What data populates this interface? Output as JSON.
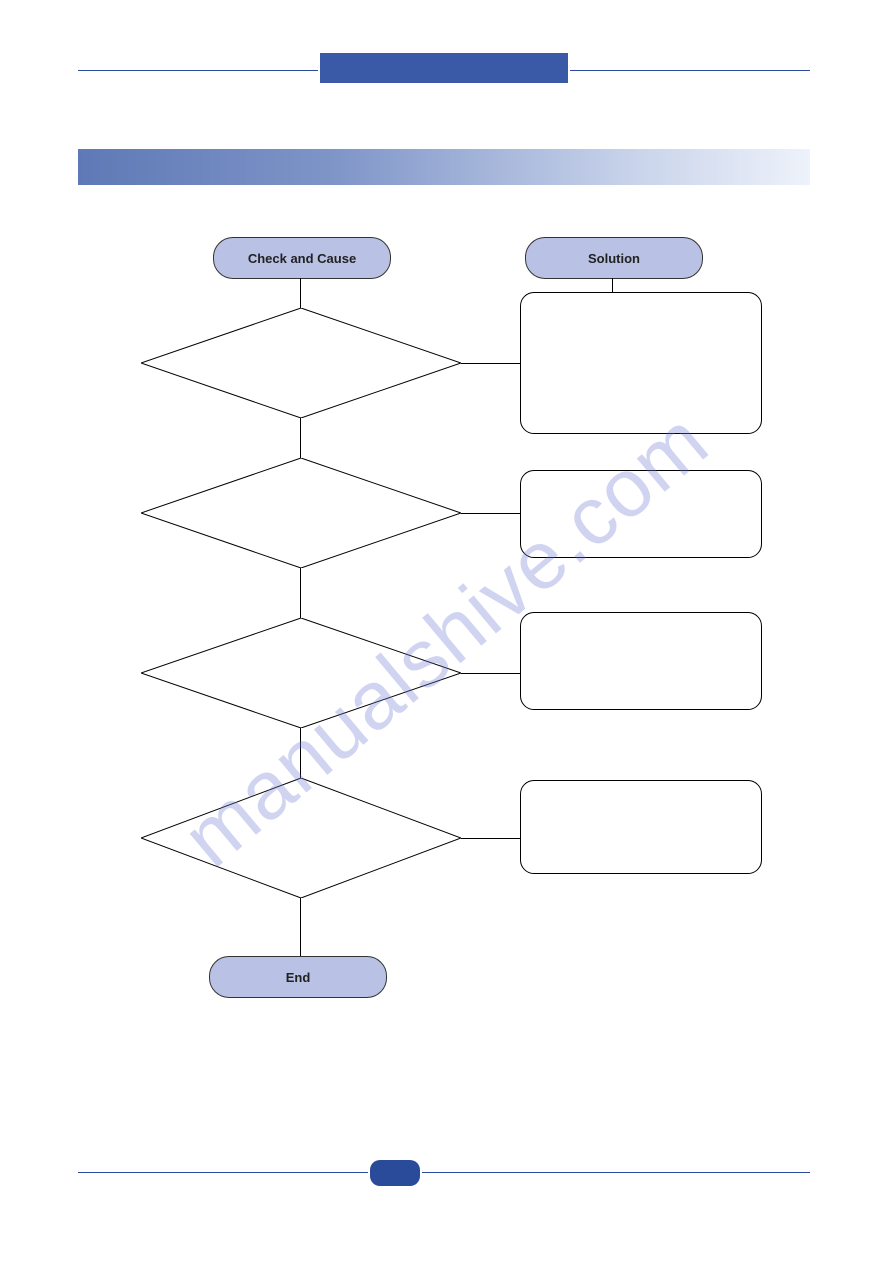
{
  "pills": {
    "check_and_cause": "Check and Cause",
    "solution": "Solution",
    "end": "End"
  },
  "watermark": "manualshive.com",
  "chart_data": {
    "type": "flowchart",
    "title": "",
    "nodes": [
      {
        "id": "check_and_cause",
        "shape": "terminator",
        "label": "Check and Cause",
        "column": "left"
      },
      {
        "id": "solution",
        "shape": "terminator",
        "label": "Solution",
        "column": "right"
      },
      {
        "id": "d1",
        "shape": "decision",
        "label": "",
        "column": "left"
      },
      {
        "id": "d2",
        "shape": "decision",
        "label": "",
        "column": "left"
      },
      {
        "id": "d3",
        "shape": "decision",
        "label": "",
        "column": "left"
      },
      {
        "id": "d4",
        "shape": "decision",
        "label": "",
        "column": "left"
      },
      {
        "id": "r1",
        "shape": "process",
        "label": "",
        "column": "right"
      },
      {
        "id": "r2",
        "shape": "process",
        "label": "",
        "column": "right"
      },
      {
        "id": "r3",
        "shape": "process",
        "label": "",
        "column": "right"
      },
      {
        "id": "r4",
        "shape": "process",
        "label": "",
        "column": "right"
      },
      {
        "id": "end",
        "shape": "terminator",
        "label": "End",
        "column": "left"
      }
    ],
    "edges": [
      {
        "from": "check_and_cause",
        "to": "d1"
      },
      {
        "from": "solution",
        "to": "r1"
      },
      {
        "from": "d1",
        "to": "r1",
        "branch": "right"
      },
      {
        "from": "d1",
        "to": "d2",
        "branch": "down"
      },
      {
        "from": "d2",
        "to": "r2",
        "branch": "right"
      },
      {
        "from": "d2",
        "to": "d3",
        "branch": "down"
      },
      {
        "from": "d3",
        "to": "r3",
        "branch": "right"
      },
      {
        "from": "d3",
        "to": "d4",
        "branch": "down"
      },
      {
        "from": "d4",
        "to": "r4",
        "branch": "right"
      },
      {
        "from": "d4",
        "to": "end",
        "branch": "down"
      }
    ],
    "colors": {
      "terminator_fill": "#b9c1e4",
      "stroke": "#000000",
      "header_gradient_start": "#5e79b6",
      "header_gradient_end": "#eef2fa",
      "accent": "#2a4a9a"
    }
  }
}
